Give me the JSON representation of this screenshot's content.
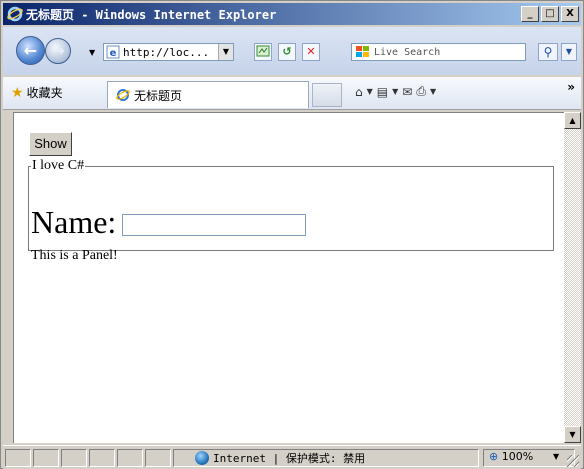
{
  "window": {
    "title": "无标题页 - Windows Internet Explorer",
    "min_label": "_",
    "max_label": "□",
    "close_label": "X"
  },
  "address_bar": {
    "url": "http://loc...",
    "search_placeholder": "Live Search"
  },
  "favorites": {
    "label": "收藏夹"
  },
  "tab": {
    "title": "无标题页"
  },
  "content": {
    "show_button": "Show",
    "panel_legend": "I love C#",
    "name_label": "Name:",
    "name_value": "",
    "panel_text": "This is a Panel!"
  },
  "status_bar": {
    "zone": "Internet | 保护模式: 禁用",
    "zoom": "100%"
  },
  "colors": {
    "title_start": "#0a246a",
    "title_end": "#a6caf0",
    "window_bg": "#d4d0c8"
  }
}
